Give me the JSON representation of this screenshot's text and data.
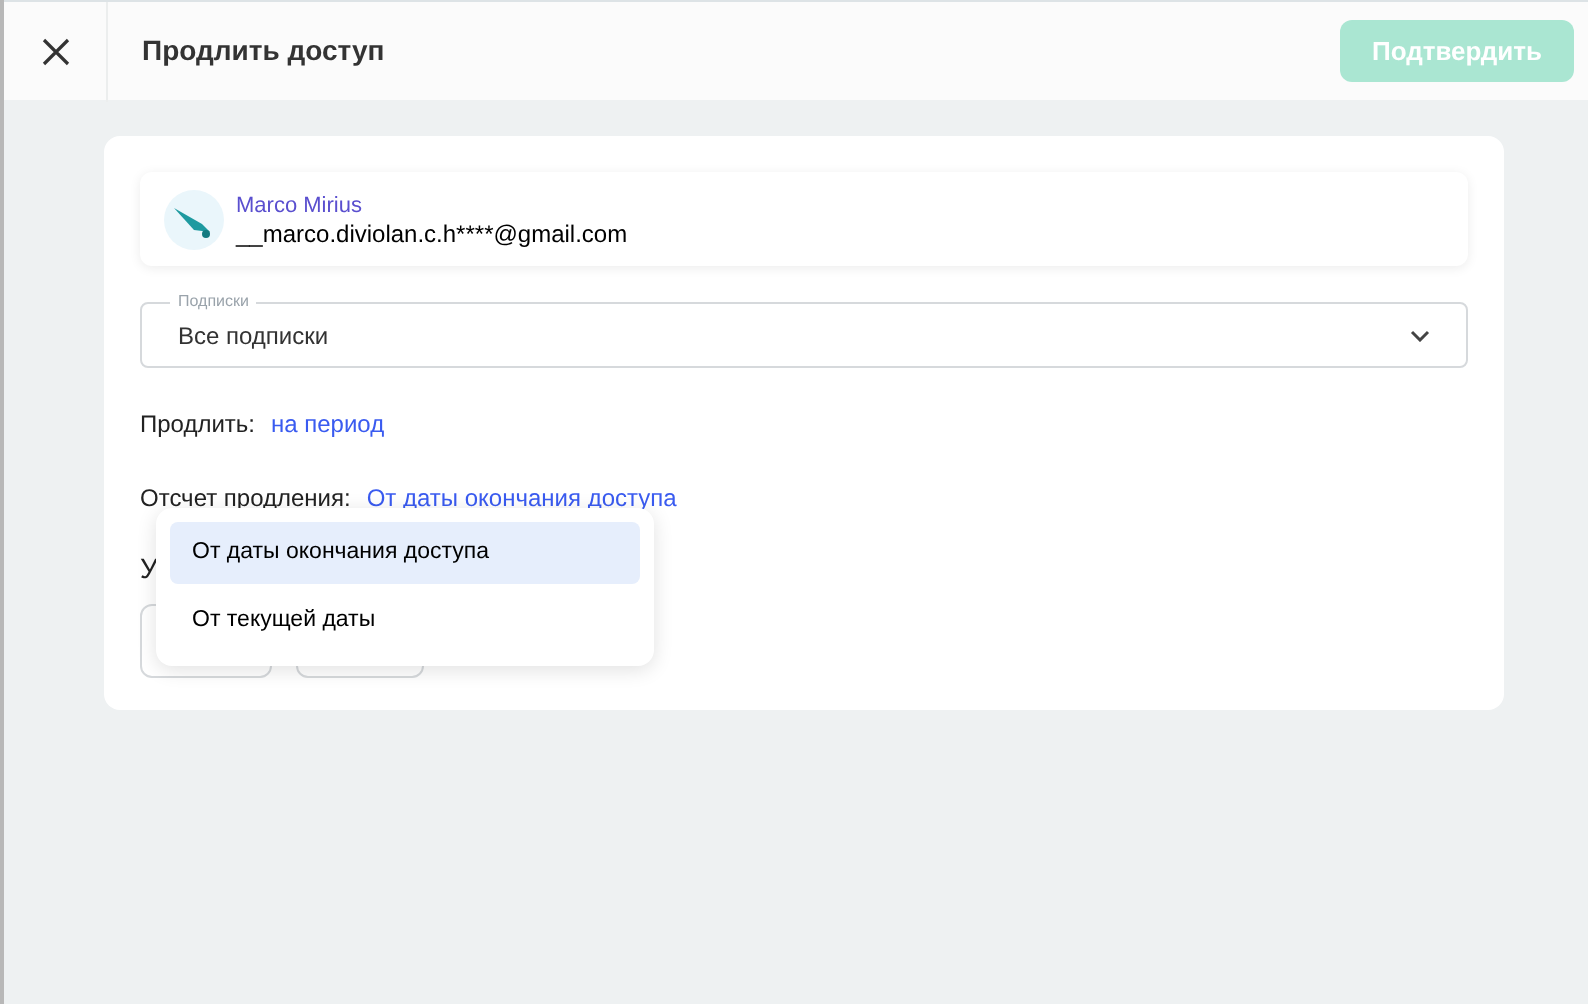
{
  "header": {
    "title": "Продлить доступ",
    "confirm_button": {
      "label": "Подтвердить",
      "disabled": true
    }
  },
  "user": {
    "name": "Marco Mirius",
    "email": "__marco.diviolan.c.h****@gmail.com"
  },
  "subscriptions_select": {
    "label": "Подписки",
    "value": "Все подписки"
  },
  "extend": {
    "label": "Продлить:",
    "value": "на период"
  },
  "count_from": {
    "label": "Отсчет продления:",
    "value": "От даты окончания доступа"
  },
  "hidden_row_label": "У",
  "count_from_menu": [
    {
      "label": "От даты окончания доступа",
      "selected": true
    },
    {
      "label": "От текущей даты",
      "selected": false
    }
  ]
}
